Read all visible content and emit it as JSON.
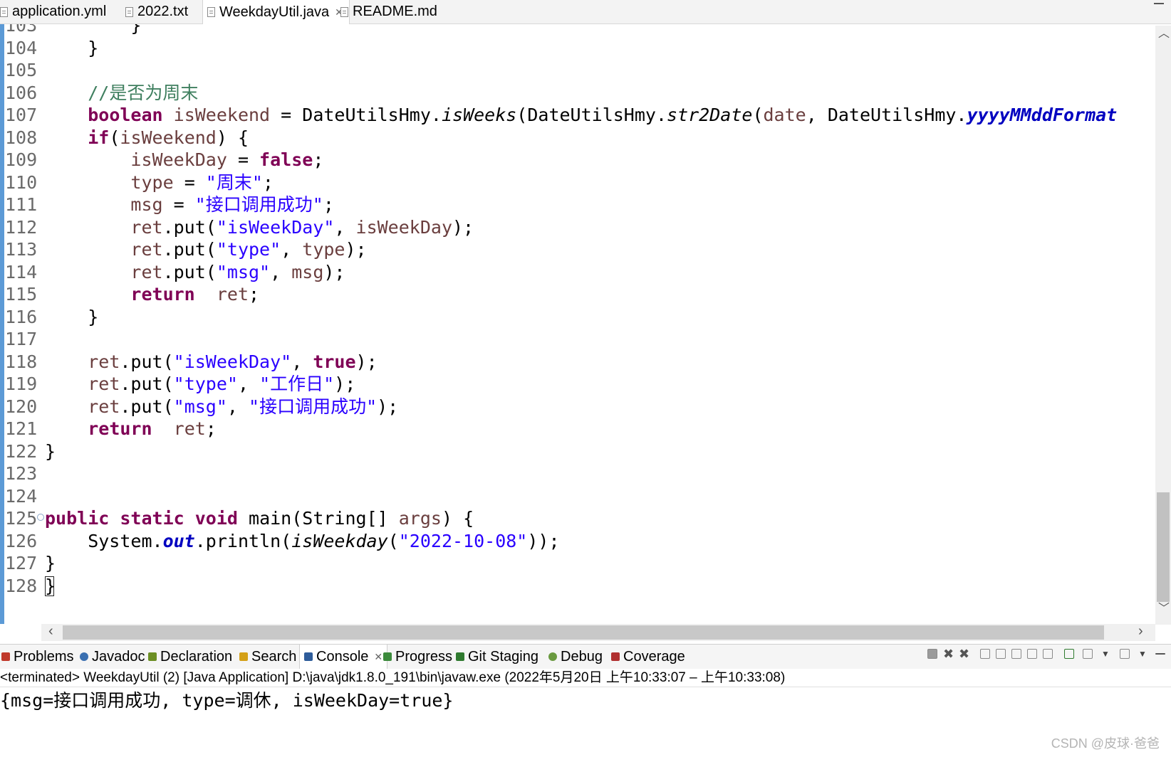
{
  "editor_tabs": [
    {
      "label": "application.yml",
      "active": false
    },
    {
      "label": "2022.txt",
      "active": false
    },
    {
      "label": "WeekdayUtil.java",
      "active": true,
      "close": "✕"
    },
    {
      "label": "README.md",
      "active": false
    }
  ],
  "code_lines": [
    {
      "num": "103",
      "html": "        }"
    },
    {
      "num": "104",
      "html": "    }"
    },
    {
      "num": "105",
      "html": ""
    },
    {
      "num": "106",
      "html": "    <span class=\"cmt\">//是否为周末</span>"
    },
    {
      "num": "107",
      "html": "    <span class=\"kw\">boolean</span> <span class=\"var\">isWeekend</span> = DateUtilsHmy.<span class=\"it\">isWeeks</span>(DateUtilsHmy.<span class=\"it\">str2Date</span>(<span class=\"var\">date</span>, DateUtilsHmy.<span class=\"stat\">yyyyMMddFormat</span>"
    },
    {
      "num": "108",
      "html": "    <span class=\"kw\">if</span>(<span class=\"var\">isWeekend</span>) {"
    },
    {
      "num": "109",
      "html": "        <span class=\"var\">isWeekDay</span> = <span class=\"kw\">false</span>;"
    },
    {
      "num": "110",
      "html": "        <span class=\"var\">type</span> = <span class=\"str\">\"周末\"</span>;"
    },
    {
      "num": "111",
      "html": "        <span class=\"var\">msg</span> = <span class=\"str\">\"接口调用成功\"</span>;"
    },
    {
      "num": "112",
      "html": "        <span class=\"var\">ret</span>.put(<span class=\"str\">\"isWeekDay\"</span>, <span class=\"var\">isWeekDay</span>);"
    },
    {
      "num": "113",
      "html": "        <span class=\"var\">ret</span>.put(<span class=\"str\">\"type\"</span>, <span class=\"var\">type</span>);"
    },
    {
      "num": "114",
      "html": "        <span class=\"var\">ret</span>.put(<span class=\"str\">\"msg\"</span>, <span class=\"var\">msg</span>);"
    },
    {
      "num": "115",
      "html": "        <span class=\"kw\">return</span>  <span class=\"var\">ret</span>;"
    },
    {
      "num": "116",
      "html": "    }"
    },
    {
      "num": "117",
      "html": ""
    },
    {
      "num": "118",
      "html": "    <span class=\"var\">ret</span>.put(<span class=\"str\">\"isWeekDay\"</span>, <span class=\"kw\">true</span>);"
    },
    {
      "num": "119",
      "html": "    <span class=\"var\">ret</span>.put(<span class=\"str\">\"type\"</span>, <span class=\"str\">\"工作日\"</span>);"
    },
    {
      "num": "120",
      "html": "    <span class=\"var\">ret</span>.put(<span class=\"str\">\"msg\"</span>, <span class=\"str\">\"接口调用成功\"</span>);"
    },
    {
      "num": "121",
      "html": "    <span class=\"kw\">return</span>  <span class=\"var\">ret</span>;"
    },
    {
      "num": "122",
      "html": "}"
    },
    {
      "num": "123",
      "html": ""
    },
    {
      "num": "124",
      "html": ""
    },
    {
      "num": "125",
      "html": "<span class=\"kw\">public</span> <span class=\"kw\">static</span> <span class=\"kw\">void</span> main(String[] <span class=\"var\">args</span>) {",
      "fold": true
    },
    {
      "num": "126",
      "html": "    System.<span class=\"stat\">out</span>.println(<span class=\"it\">isWeekday</span>(<span class=\"str\">\"2022-10-08\"</span>));"
    },
    {
      "num": "127",
      "html": "}"
    },
    {
      "num": "128",
      "html": "}",
      "caret": true
    }
  ],
  "view_tabs": [
    {
      "label": "Problems",
      "color": "#c0392b",
      "active": false
    },
    {
      "label": "Javadoc",
      "color": "#3a6fb0",
      "active": false
    },
    {
      "label": "Declaration",
      "color": "#6b8e23",
      "active": false
    },
    {
      "label": "Search",
      "color": "#d4a017",
      "active": false
    },
    {
      "label": "Console",
      "color": "#2e5c9a",
      "active": true,
      "close": "✕"
    },
    {
      "label": "Progress",
      "color": "#3c8a3c",
      "active": false
    },
    {
      "label": "Git Staging",
      "color": "#2f7a2f",
      "active": false
    },
    {
      "label": "Debug",
      "color": "#6a9a40",
      "active": false
    },
    {
      "label": "Coverage",
      "color": "#b03030",
      "active": false
    }
  ],
  "console": {
    "header": "<terminated> WeekdayUtil (2) [Java Application] D:\\java\\jdk1.8.0_191\\bin\\javaw.exe  (2022年5月20日 上午10:33:07 – 上午10:33:08)",
    "output": "{msg=接口调用成功, type=调休, isWeekDay=true}"
  },
  "watermark": "CSDN @皮球·爸爸"
}
